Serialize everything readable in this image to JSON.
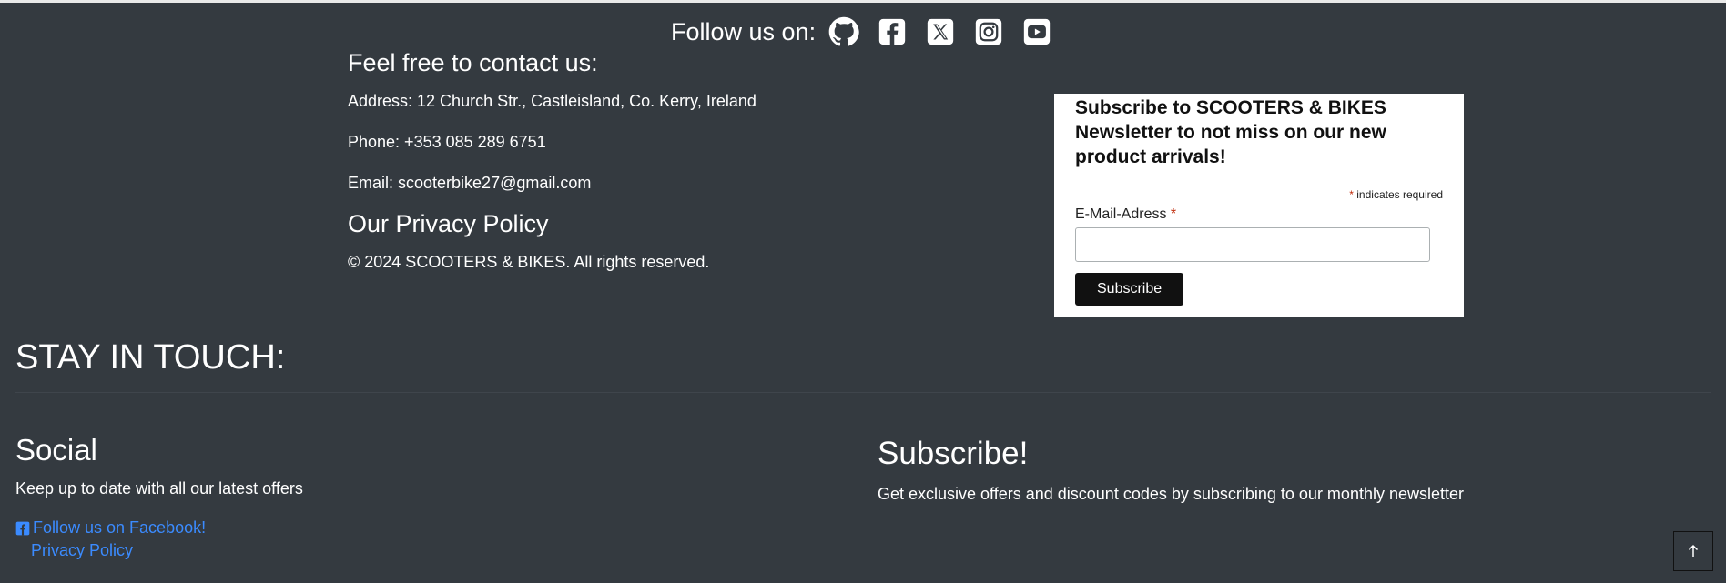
{
  "follow": {
    "label": "Follow us on:",
    "icons": [
      "github-icon",
      "facebook-icon",
      "x-icon",
      "instagram-icon",
      "youtube-icon"
    ]
  },
  "contact": {
    "heading": "Feel free to contact us:",
    "address": "Address: 12 Church Str., Castleisland, Co. Kerry, Ireland",
    "phone": "Phone: +353 085 289 6751",
    "email": "Email: scooterbike27@gmail.com",
    "privacy_heading": "Our Privacy Policy",
    "copyright": "© 2024 SCOOTERS & BIKES. All rights reserved."
  },
  "newsletter": {
    "title": "Subscribe to SCOOTERS & BIKES Newsletter to not miss on our new product arrivals!",
    "required_marker": "*",
    "required_note": "indicates required",
    "email_label": "E-Mail-Adress",
    "email_value": "",
    "button": "Subscribe"
  },
  "stay": {
    "heading": "STAY IN TOUCH:"
  },
  "social": {
    "heading": "Social",
    "text": "Keep up to date with all our latest offers",
    "facebook_link": "Follow us on Facebook!",
    "privacy_link": "Privacy Policy"
  },
  "subscribe": {
    "heading": "Subscribe!",
    "text": "Get exclusive offers and discount codes by subscribing to our monthly newsletter"
  },
  "colors": {
    "background": "#343a40",
    "link": "#3b8bff",
    "button": "#111111"
  }
}
